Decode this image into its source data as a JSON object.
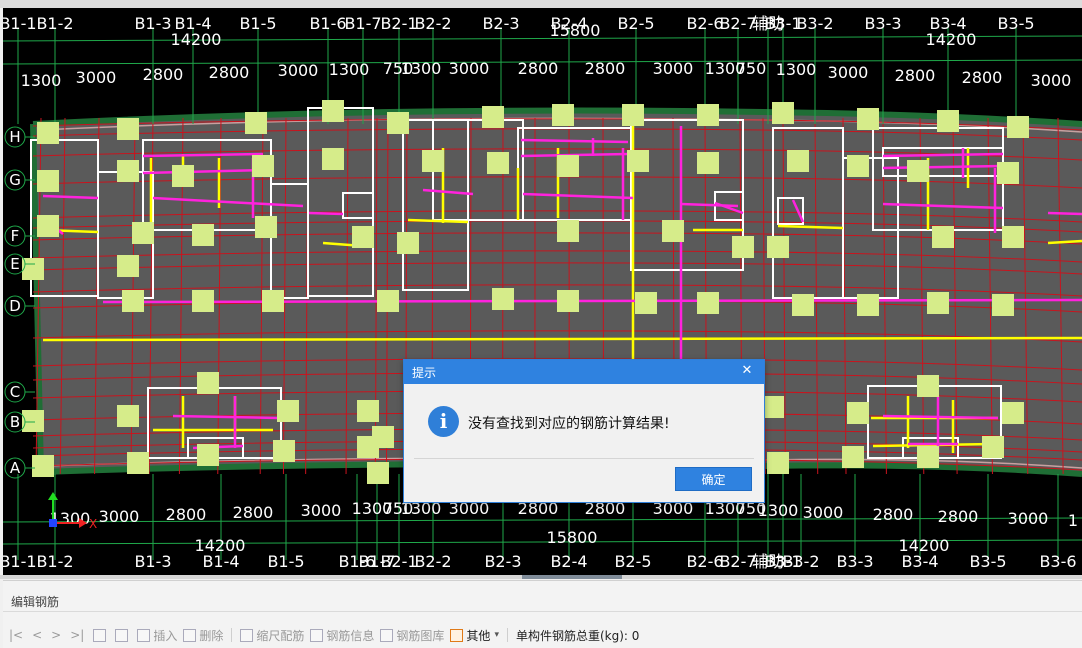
{
  "axes": {
    "top_labels": [
      "B1-1",
      "B1-2",
      "B1-3",
      "B1-4",
      "B1-5",
      "B1-6",
      "B1-7",
      "B2-1",
      "B2-2",
      "B2-3",
      "B2-4",
      "B2-5",
      "B2-6",
      "B2-7",
      "辅助",
      "B3-1",
      "B3-2",
      "B3-3",
      "B3-4",
      "B3-5"
    ],
    "bottom_labels": [
      "B1-1",
      "B1-2",
      "B1-3",
      "B1-4",
      "B1-5",
      "B1-6",
      "B1-7",
      "B2-1",
      "B2-2",
      "B2-3",
      "B2-4",
      "B2-5",
      "B2-6",
      "B2-7",
      "辅助",
      "B3-1",
      "B3-2",
      "B3-3",
      "B3-4",
      "B3-5",
      "B3-6"
    ],
    "row_labels": [
      "H",
      "G",
      "F",
      "E",
      "D",
      "C",
      "B",
      "A"
    ]
  },
  "dimensions": {
    "top_totals": [
      "14200",
      "15800",
      "14200"
    ],
    "top_row": [
      "1300",
      "3000",
      "2800",
      "2800",
      "3000",
      "1300",
      "750",
      "1300",
      "3000",
      "2800",
      "2800",
      "3000",
      "1300",
      "750",
      "1300",
      "3000",
      "2800",
      "2800",
      "3000"
    ],
    "bottom_row": [
      "1300",
      "3000",
      "2800",
      "2800",
      "3000",
      "1300",
      "750",
      "1300",
      "3000",
      "2800",
      "2800",
      "3000",
      "1300",
      "750",
      "1300",
      "3000",
      "2800",
      "2800",
      "3000",
      "1"
    ],
    "bottom_totals": [
      "14200",
      "15800",
      "14200"
    ]
  },
  "ucs": {
    "x": "X"
  },
  "dialog": {
    "title": "提示",
    "close_glyph": "✕",
    "icon_glyph": "i",
    "message": "没有查找到对应的钢筋计算结果!",
    "ok_label": "确定"
  },
  "panel": {
    "title": "编辑钢筋",
    "nav": [
      "|<",
      "<",
      ">",
      ">|"
    ],
    "tools": {
      "insert": "插入",
      "delete": "删除",
      "scale": "缩尺配筋",
      "info": "钢筋信息",
      "library": "钢筋图库",
      "other": "其他"
    },
    "weight_label": "单构件钢筋总重(kg):",
    "weight_value": "0"
  },
  "colors": {
    "canvas_bg": "#000000",
    "grid": "#c8141e",
    "slab": "#5a5a5a",
    "outline": "#1f6e35",
    "column": "#d6ec8a",
    "beam_white": "#ffffff",
    "beam_yellow": "#ffff00",
    "beam_magenta": "#ff22dd",
    "axis_green": "#1fa84a",
    "dialog_blue": "#2f82e0"
  }
}
